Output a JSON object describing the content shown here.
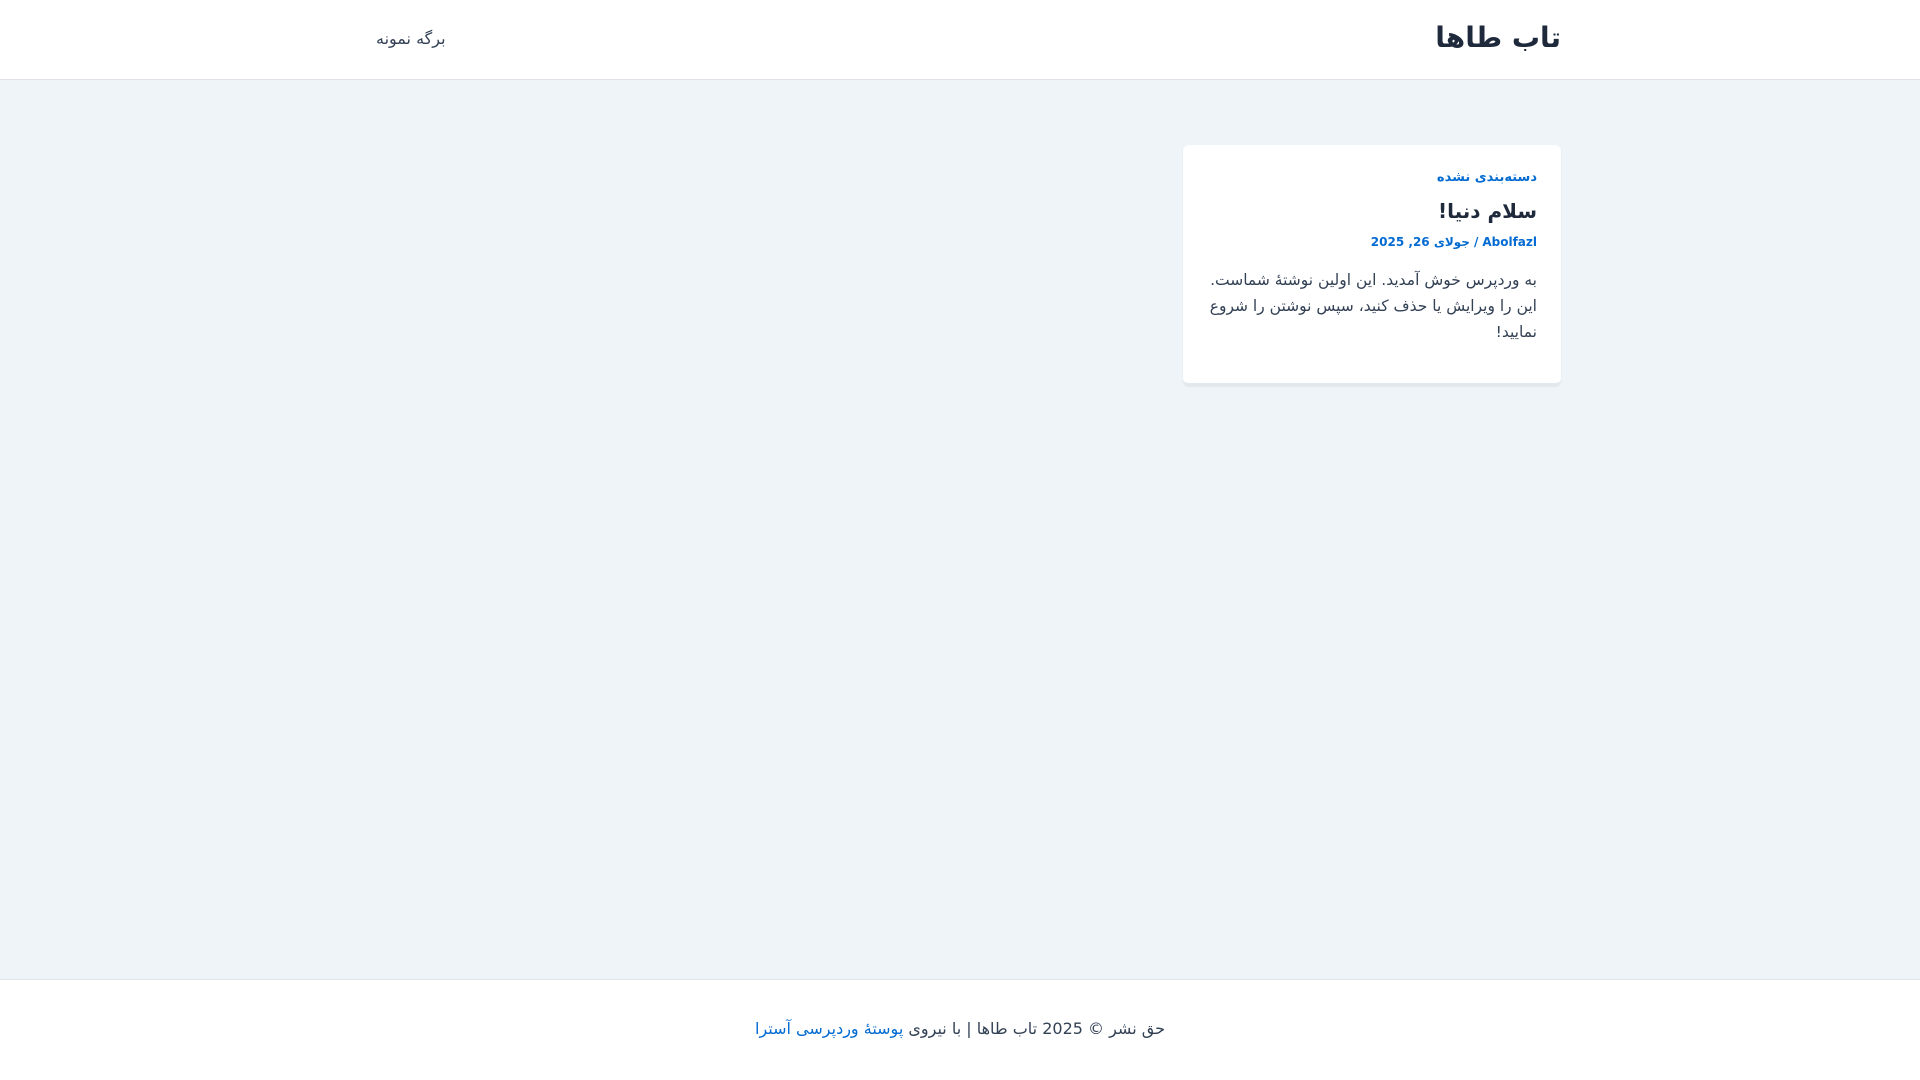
{
  "header": {
    "site_title": "تاب طاها",
    "nav": {
      "sample_page": "برگه نمونه"
    }
  },
  "post": {
    "category": "دسته‌بندی نشده",
    "title": "سلام دنیا!",
    "author": "Abolfazl",
    "separator": "/",
    "date": "جولای 26, 2025",
    "excerpt": "به وردپرس خوش آمدید. این اولین نوشتهٔ شماست. این را ویرایش یا حذف کنید، سپس نوشتن را شروع نمایید!"
  },
  "footer": {
    "copyright_text": "حق نشر © 2025 تاب طاها | با نیروی",
    "powered_by_link": "پوستهٔ وردپرسی آسترا"
  },
  "colors": {
    "accent": "#046bd2",
    "heading": "#1e293b",
    "text": "#334155",
    "background": "#eef4f8"
  }
}
